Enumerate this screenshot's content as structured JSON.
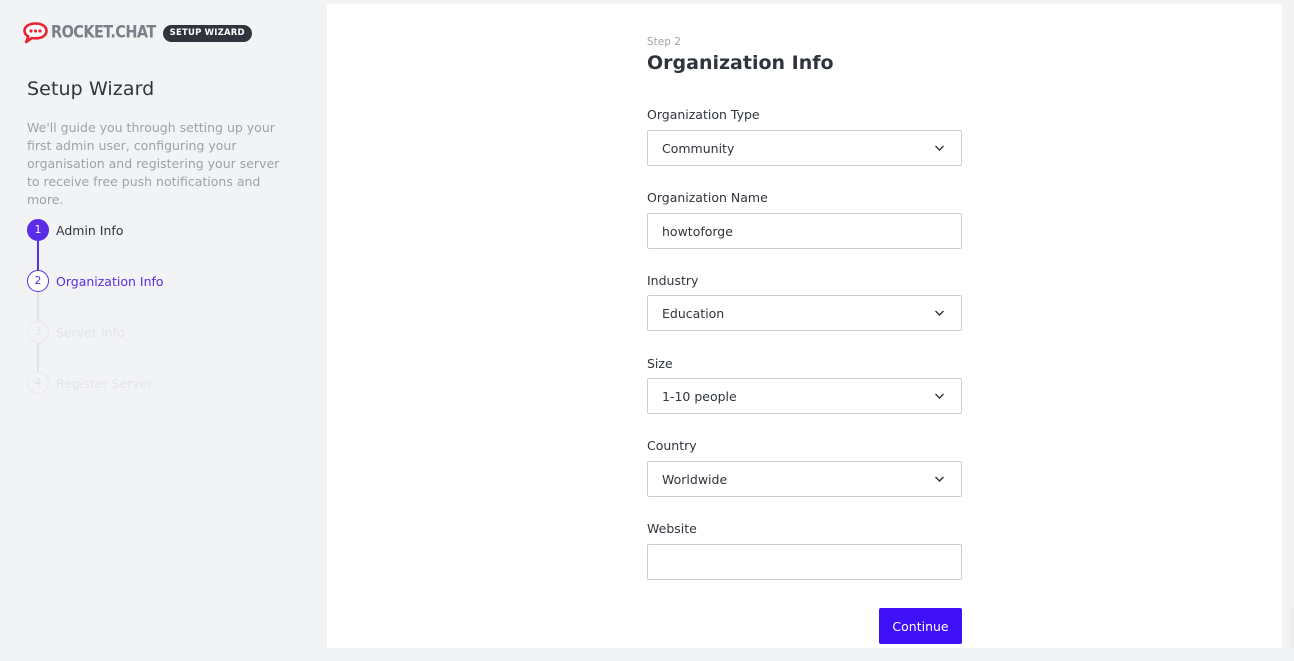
{
  "brand": {
    "name": "ROCKET.CHAT",
    "badge": "SETUP WIZARD",
    "logo_color": "#e8242f"
  },
  "sidebar": {
    "title": "Setup Wizard",
    "description": "We'll guide you through setting up your first admin user, configuring your organisation and registering your server to receive free push notifications and more.",
    "steps": [
      {
        "number": "1",
        "label": "Admin Info",
        "state": "done"
      },
      {
        "number": "2",
        "label": "Organization Info",
        "state": "current"
      },
      {
        "number": "3",
        "label": "Server Info",
        "state": "todo"
      },
      {
        "number": "4",
        "label": "Register Server",
        "state": "todo"
      }
    ]
  },
  "form": {
    "step_label": "Step 2",
    "title": "Organization Info",
    "fields": {
      "org_type": {
        "label": "Organization Type",
        "value": "Community",
        "kind": "select"
      },
      "org_name": {
        "label": "Organization Name",
        "value": "howtoforge",
        "kind": "text"
      },
      "industry": {
        "label": "Industry",
        "value": "Education",
        "kind": "select"
      },
      "size": {
        "label": "Size",
        "value": "1-10 people",
        "kind": "select"
      },
      "country": {
        "label": "Country",
        "value": "Worldwide",
        "kind": "select"
      },
      "website": {
        "label": "Website",
        "value": "",
        "kind": "text"
      }
    },
    "continue_label": "Continue"
  },
  "colors": {
    "accent": "#5b2ce8",
    "button": "#3f0ff7",
    "sidebar_bg": "#f2f3f5",
    "panel_bg": "#ffffff"
  }
}
